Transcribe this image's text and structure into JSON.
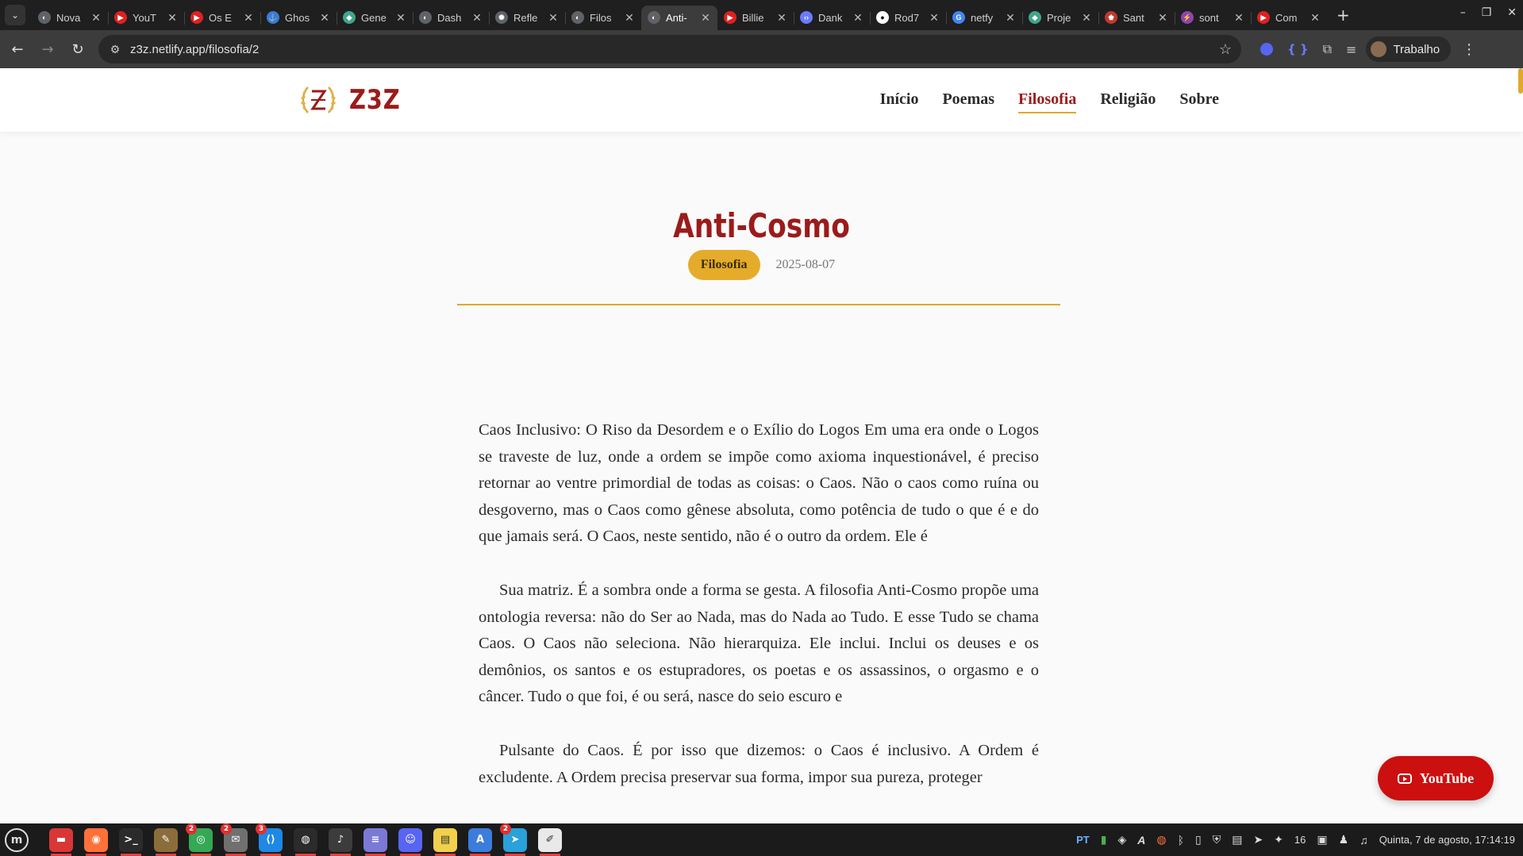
{
  "browser": {
    "tabs": [
      {
        "title": "Nova",
        "fav_color": "#5f6368",
        "fav_glyph": "◐"
      },
      {
        "title": "YouT",
        "fav_color": "#e02020",
        "fav_glyph": "▶"
      },
      {
        "title": "Os E",
        "fav_color": "#e02020",
        "fav_glyph": "▶"
      },
      {
        "title": "Ghos",
        "fav_color": "#3a7bd5",
        "fav_glyph": "⚓"
      },
      {
        "title": "Gene",
        "fav_color": "#3fa58b",
        "fav_glyph": "◆"
      },
      {
        "title": "Dash",
        "fav_color": "#5f6368",
        "fav_glyph": "◐"
      },
      {
        "title": "Refle",
        "fav_color": "#5f6368",
        "fav_glyph": "✺"
      },
      {
        "title": "Filos",
        "fav_color": "#5f6368",
        "fav_glyph": "◐"
      },
      {
        "title": "Anti-",
        "fav_color": "#5f6368",
        "fav_glyph": "◐"
      },
      {
        "title": "Billie",
        "fav_color": "#e02020",
        "fav_glyph": "▶"
      },
      {
        "title": "Dank",
        "fav_color": "#6b7bff",
        "fav_glyph": "‹›"
      },
      {
        "title": "Rod7",
        "fav_color": "#ffffff",
        "fav_glyph": "●"
      },
      {
        "title": "netfy",
        "fav_color": "#4285f4",
        "fav_glyph": "G"
      },
      {
        "title": "Proje",
        "fav_color": "#3fa58b",
        "fav_glyph": "◆"
      },
      {
        "title": "Sant",
        "fav_color": "#c0392b",
        "fav_glyph": "♚"
      },
      {
        "title": "sont",
        "fav_color": "#8e44ad",
        "fav_glyph": "⚡"
      },
      {
        "title": "Com",
        "fav_color": "#e02020",
        "fav_glyph": "▶"
      }
    ],
    "active_tab_index": 8,
    "url": "z3z.netlify.app/filosofia/2",
    "profile_name": "Trabalho"
  },
  "site": {
    "logo_text": "Z3Z",
    "nav": [
      {
        "label": "Início",
        "active": false
      },
      {
        "label": "Poemas",
        "active": false
      },
      {
        "label": "Filosofia",
        "active": true
      },
      {
        "label": "Religião",
        "active": false
      },
      {
        "label": "Sobre",
        "active": false
      }
    ],
    "colors": {
      "brand_red": "#9b1b1b",
      "accent_gold": "#e5ab2a",
      "youtube_red": "#cc0f0f"
    }
  },
  "article": {
    "title": "Anti-Cosmo",
    "category": "Filosofia",
    "date": "2025-08-07",
    "paragraphs": [
      "Caos Inclusivo: O Riso da Desordem e o Exílio do Logos Em uma era onde o Logos se traveste de luz, onde a ordem se impõe como axioma inquestionável, é preciso retornar ao ventre primordial de todas as coisas: o Caos. Não o caos como ruína ou desgoverno, mas o Caos como gênese absoluta, como potência de tudo o que é e do que jamais será. O Caos, neste sentido, não é o outro da ordem. Ele é",
      "Sua matriz. É a sombra onde a forma se gesta. A filosofia Anti-Cosmo propõe uma ontologia reversa: não do Ser ao Nada, mas do Nada ao Tudo. E esse Tudo se chama Caos. O Caos não seleciona. Não hierarquiza. Ele inclui. Inclui os deuses e os demônios, os santos e os estupradores, os poetas e os assassinos, o orgasmo e o câncer. Tudo o que foi, é ou será, nasce do seio escuro e",
      "Pulsante do Caos. É por isso que dizemos: o Caos é inclusivo. A Ordem é excludente. A Ordem precisa preservar sua forma, impor sua pureza, proteger"
    ]
  },
  "floating_button": {
    "label": "YouTube"
  },
  "taskbar": {
    "apps": [
      {
        "name": "files",
        "color": "#d93636",
        "glyph": "▬",
        "badge": ""
      },
      {
        "name": "firefox",
        "color": "#ff7139",
        "glyph": "◉",
        "badge": ""
      },
      {
        "name": "terminal",
        "color": "#2b2b2b",
        "glyph": ">_",
        "badge": ""
      },
      {
        "name": "gimp",
        "color": "#8a6d3b",
        "glyph": "✎",
        "badge": ""
      },
      {
        "name": "chrome",
        "color": "#34a853",
        "glyph": "◎",
        "badge": "2"
      },
      {
        "name": "mail",
        "color": "#707070",
        "glyph": "✉",
        "badge": "2"
      },
      {
        "name": "vscode",
        "color": "#1e88e5",
        "glyph": "⟨⟩",
        "badge": "3"
      },
      {
        "name": "obs",
        "color": "#2b2b2b",
        "glyph": "◍",
        "badge": ""
      },
      {
        "name": "audio",
        "color": "#3c3c3c",
        "glyph": "♪",
        "badge": ""
      },
      {
        "name": "notes",
        "color": "#7a7ad6",
        "glyph": "≡",
        "badge": ""
      },
      {
        "name": "discord",
        "color": "#5865f2",
        "glyph": "☺",
        "badge": ""
      },
      {
        "name": "sticky",
        "color": "#f1d04b",
        "glyph": "▤",
        "badge": ""
      },
      {
        "name": "fonts",
        "color": "#3b7ddd",
        "glyph": "A",
        "badge": ""
      },
      {
        "name": "telegram",
        "color": "#2aa1d9",
        "glyph": "➤",
        "badge": "2"
      },
      {
        "name": "editor",
        "color": "#e9e9e9",
        "glyph": "✐",
        "badge": ""
      }
    ],
    "tray": {
      "lang": "PT",
      "notifications_count": "16",
      "clock": "Quinta, 7 de agosto, 17:14:19"
    }
  }
}
